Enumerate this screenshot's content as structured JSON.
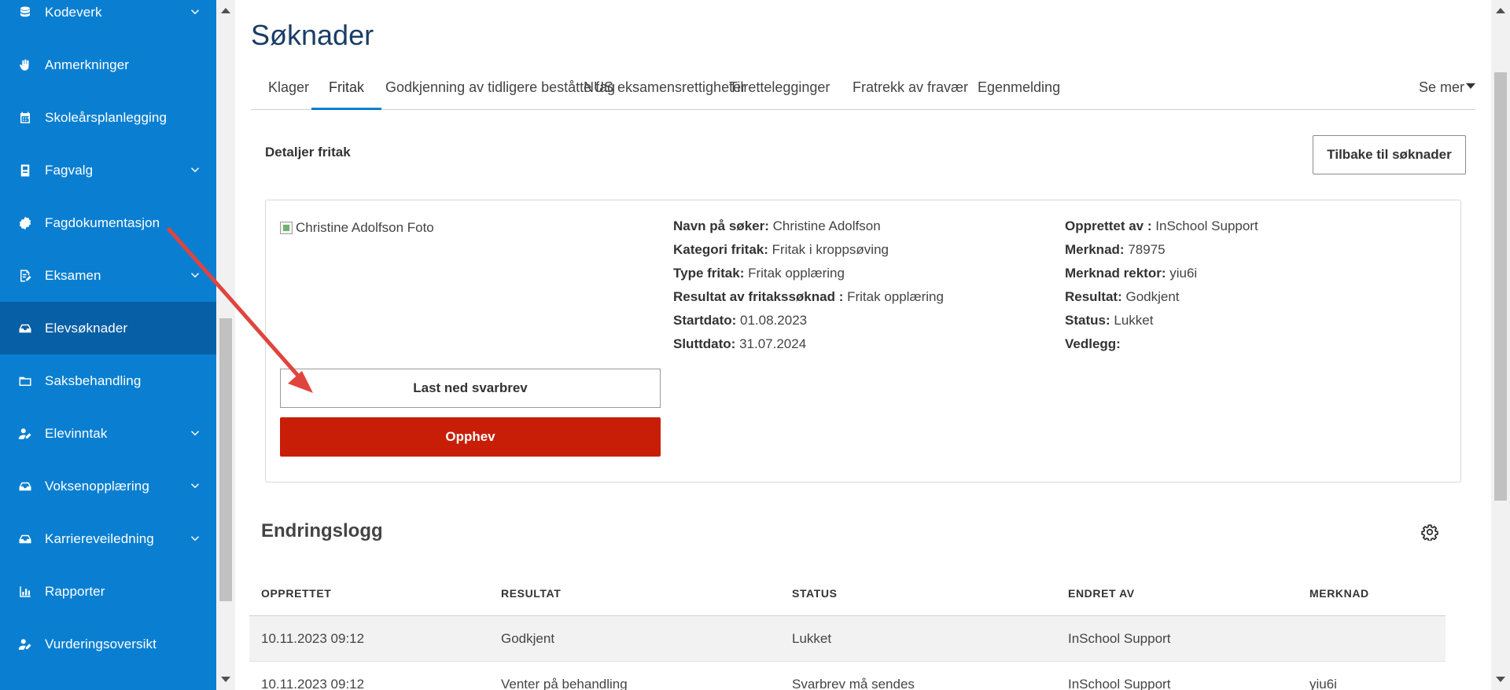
{
  "colors": {
    "sidebar": "#0a7fd1",
    "sidebar_active": "#075fa5",
    "accent": "#0a7fd1",
    "danger": "#c81e07",
    "annotation": "#e0443e"
  },
  "sidebar": {
    "items": [
      {
        "label": "Kodeverk",
        "icon": "database-icon",
        "expandable": true
      },
      {
        "label": "Anmerkninger",
        "icon": "hand-icon",
        "expandable": false
      },
      {
        "label": "Skoleårsplanlegging",
        "icon": "calendar-icon",
        "expandable": false
      },
      {
        "label": "Fagvalg",
        "icon": "book-icon",
        "expandable": true
      },
      {
        "label": "Fagdokumentasjon",
        "icon": "badge-icon",
        "expandable": false
      },
      {
        "label": "Eksamen",
        "icon": "edit-document-icon",
        "expandable": true
      },
      {
        "label": "Elevsøknader",
        "icon": "inbox-icon",
        "expandable": false,
        "active": true
      },
      {
        "label": "Saksbehandling",
        "icon": "folder-icon",
        "expandable": false
      },
      {
        "label": "Elevinntak",
        "icon": "user-edit-icon",
        "expandable": true
      },
      {
        "label": "Voksenopplæring",
        "icon": "inbox-icon",
        "expandable": true
      },
      {
        "label": "Karriereveiledning",
        "icon": "inbox-icon",
        "expandable": true
      },
      {
        "label": "Rapporter",
        "icon": "bar-chart-icon",
        "expandable": false
      },
      {
        "label": "Vurderingsoversikt",
        "icon": "user-edit-icon",
        "expandable": false
      }
    ]
  },
  "page": {
    "title": "Søknader"
  },
  "tabs": {
    "items": [
      "Klager",
      "Fritak",
      "Godkjenning av tidligere beståtte fag",
      "NUS eksamensrettigheter",
      "Tilrettelegginger",
      "Fratrekk av fravær",
      "Egenmelding"
    ],
    "active": "Fritak",
    "more": "Se mer"
  },
  "details": {
    "title": "Detaljer fritak",
    "back_button": "Tilbake til søknader",
    "photo_alt": "Christine Adolfson Foto",
    "download_button": "Last ned svarbrev",
    "revoke_button": "Opphev",
    "col_mid": [
      {
        "k": "Navn på søker:",
        "v": "Christine Adolfson"
      },
      {
        "k": "Kategori fritak:",
        "v": "Fritak i kroppsøving"
      },
      {
        "k": "Type fritak:",
        "v": "Fritak opplæring"
      },
      {
        "k": "Resultat av fritakssøknad :",
        "v": "Fritak opplæring"
      },
      {
        "k": "Startdato:",
        "v": "01.08.2023"
      },
      {
        "k": "Sluttdato:",
        "v": "31.07.2024"
      }
    ],
    "col_right": [
      {
        "k": "Opprettet av :",
        "v": "InSchool Support"
      },
      {
        "k": "Merknad:",
        "v": "78975"
      },
      {
        "k": "Merknad rektor:",
        "v": "yiu6i"
      },
      {
        "k": "Resultat:",
        "v": "Godkjent"
      },
      {
        "k": "Status:",
        "v": "Lukket"
      },
      {
        "k": "Vedlegg:",
        "v": ""
      }
    ]
  },
  "log": {
    "title": "Endringslogg",
    "headers": [
      "OPPRETTET",
      "RESULTAT",
      "STATUS",
      "ENDRET AV",
      "MERKNAD"
    ],
    "rows": [
      [
        "10.11.2023 09:12",
        "Godkjent",
        "Lukket",
        "InSchool Support",
        ""
      ],
      [
        "10.11.2023 09:12",
        "Venter på behandling",
        "Svarbrev må sendes",
        "InSchool Support",
        "yiu6i"
      ]
    ]
  }
}
